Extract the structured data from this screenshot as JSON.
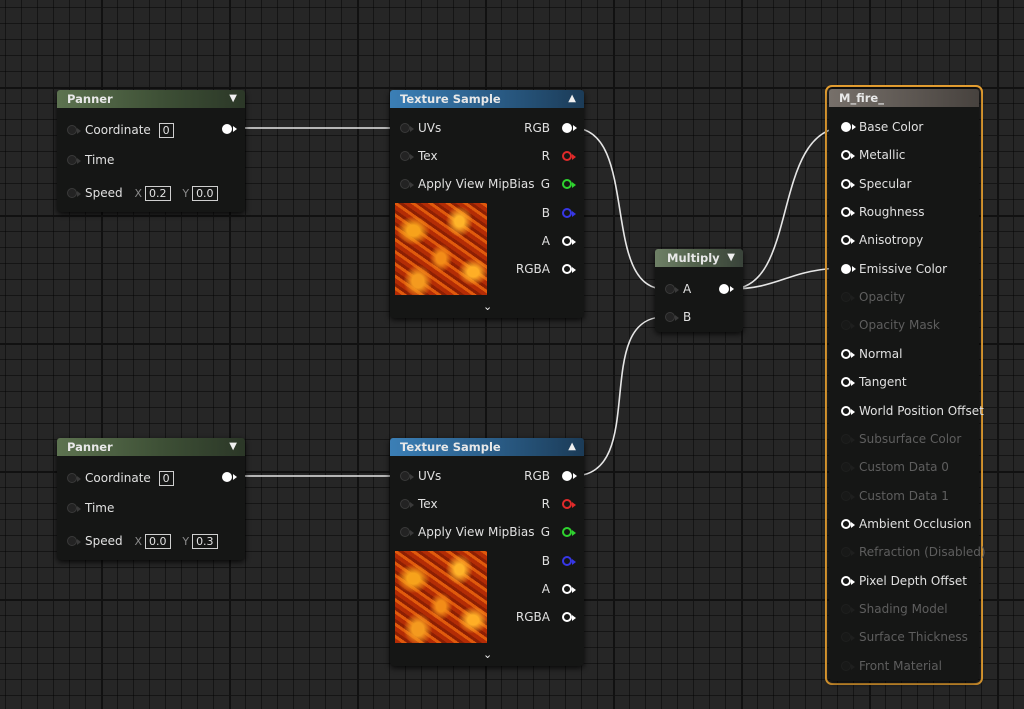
{
  "panner_nodes": [
    {
      "title": "Panner",
      "coordinate_label": "Coordinate",
      "coordinate_value": "0",
      "time_label": "Time",
      "speed_label": "Speed",
      "x_label": "X",
      "x_value": "0.2",
      "y_label": "Y",
      "y_value": "0.0"
    },
    {
      "title": "Panner",
      "coordinate_label": "Coordinate",
      "coordinate_value": "0",
      "time_label": "Time",
      "speed_label": "Speed",
      "x_label": "X",
      "x_value": "0.0",
      "y_label": "Y",
      "y_value": "0.3"
    }
  ],
  "texture_nodes": [
    {
      "title": "Texture Sample",
      "inputs": [
        "UVs",
        "Tex",
        "Apply View MipBias"
      ],
      "outputs": [
        "RGB",
        "R",
        "G",
        "B",
        "A",
        "RGBA"
      ]
    },
    {
      "title": "Texture Sample",
      "inputs": [
        "UVs",
        "Tex",
        "Apply View MipBias"
      ],
      "outputs": [
        "RGB",
        "R",
        "G",
        "B",
        "A",
        "RGBA"
      ]
    }
  ],
  "multiply_node": {
    "title": "Multiply",
    "input_a": "A",
    "input_b": "B"
  },
  "material_node": {
    "title": "M_fire_",
    "pins": [
      {
        "label": "Base Color",
        "state": "connected"
      },
      {
        "label": "Metallic",
        "state": "active"
      },
      {
        "label": "Specular",
        "state": "active"
      },
      {
        "label": "Roughness",
        "state": "active"
      },
      {
        "label": "Anisotropy",
        "state": "active"
      },
      {
        "label": "Emissive Color",
        "state": "connected"
      },
      {
        "label": "Opacity",
        "state": "disabled"
      },
      {
        "label": "Opacity Mask",
        "state": "disabled"
      },
      {
        "label": "Normal",
        "state": "active"
      },
      {
        "label": "Tangent",
        "state": "active"
      },
      {
        "label": "World Position Offset",
        "state": "active"
      },
      {
        "label": "Subsurface Color",
        "state": "disabled"
      },
      {
        "label": "Custom Data 0",
        "state": "disabled"
      },
      {
        "label": "Custom Data 1",
        "state": "disabled"
      },
      {
        "label": "Ambient Occlusion",
        "state": "active"
      },
      {
        "label": "Refraction (Disabled)",
        "state": "disabled"
      },
      {
        "label": "Pixel Depth Offset",
        "state": "active"
      },
      {
        "label": "Shading Model",
        "state": "disabled"
      },
      {
        "label": "Surface Thickness",
        "state": "disabled"
      },
      {
        "label": "Front Material",
        "state": "disabled"
      }
    ]
  },
  "colors": {
    "wire": "#e6e6e6",
    "selection": "#e8a132",
    "r_pin": "#e12a2a",
    "g_pin": "#2fd32f",
    "b_pin": "#3737e6"
  }
}
